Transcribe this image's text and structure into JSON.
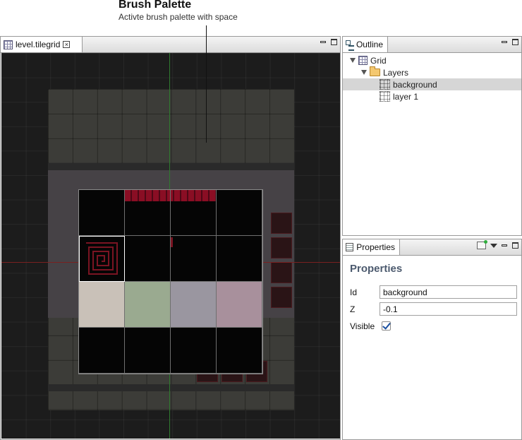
{
  "annotation": {
    "title": "Brush Palette",
    "subtitle": "Activte brush palette with space"
  },
  "editor": {
    "tab_label": "level.tilegrid",
    "tab_icon": "tilegrid-file-icon",
    "close_icon": "close-icon"
  },
  "palette": {
    "swatch_colors": [
      "#c9c1b8",
      "#9aaa90",
      "#9a96a0",
      "#a8909c"
    ],
    "selected_cell": 4
  },
  "outline": {
    "tab_label": "Outline",
    "tree": [
      {
        "label": "Grid",
        "icon": "grid-icon",
        "expanded": true,
        "depth": 0
      },
      {
        "label": "Layers",
        "icon": "folder-open-icon",
        "expanded": true,
        "depth": 1
      },
      {
        "label": "background",
        "icon": "layer-icon",
        "selected": true,
        "depth": 2
      },
      {
        "label": "layer 1",
        "icon": "layer-icon",
        "depth": 2
      }
    ]
  },
  "properties": {
    "tab_label": "Properties",
    "heading": "Properties",
    "fields": {
      "id": {
        "label": "Id",
        "value": "background"
      },
      "z": {
        "label": "Z",
        "value": "-0.1"
      },
      "visible": {
        "label": "Visible",
        "checked": true
      }
    }
  }
}
